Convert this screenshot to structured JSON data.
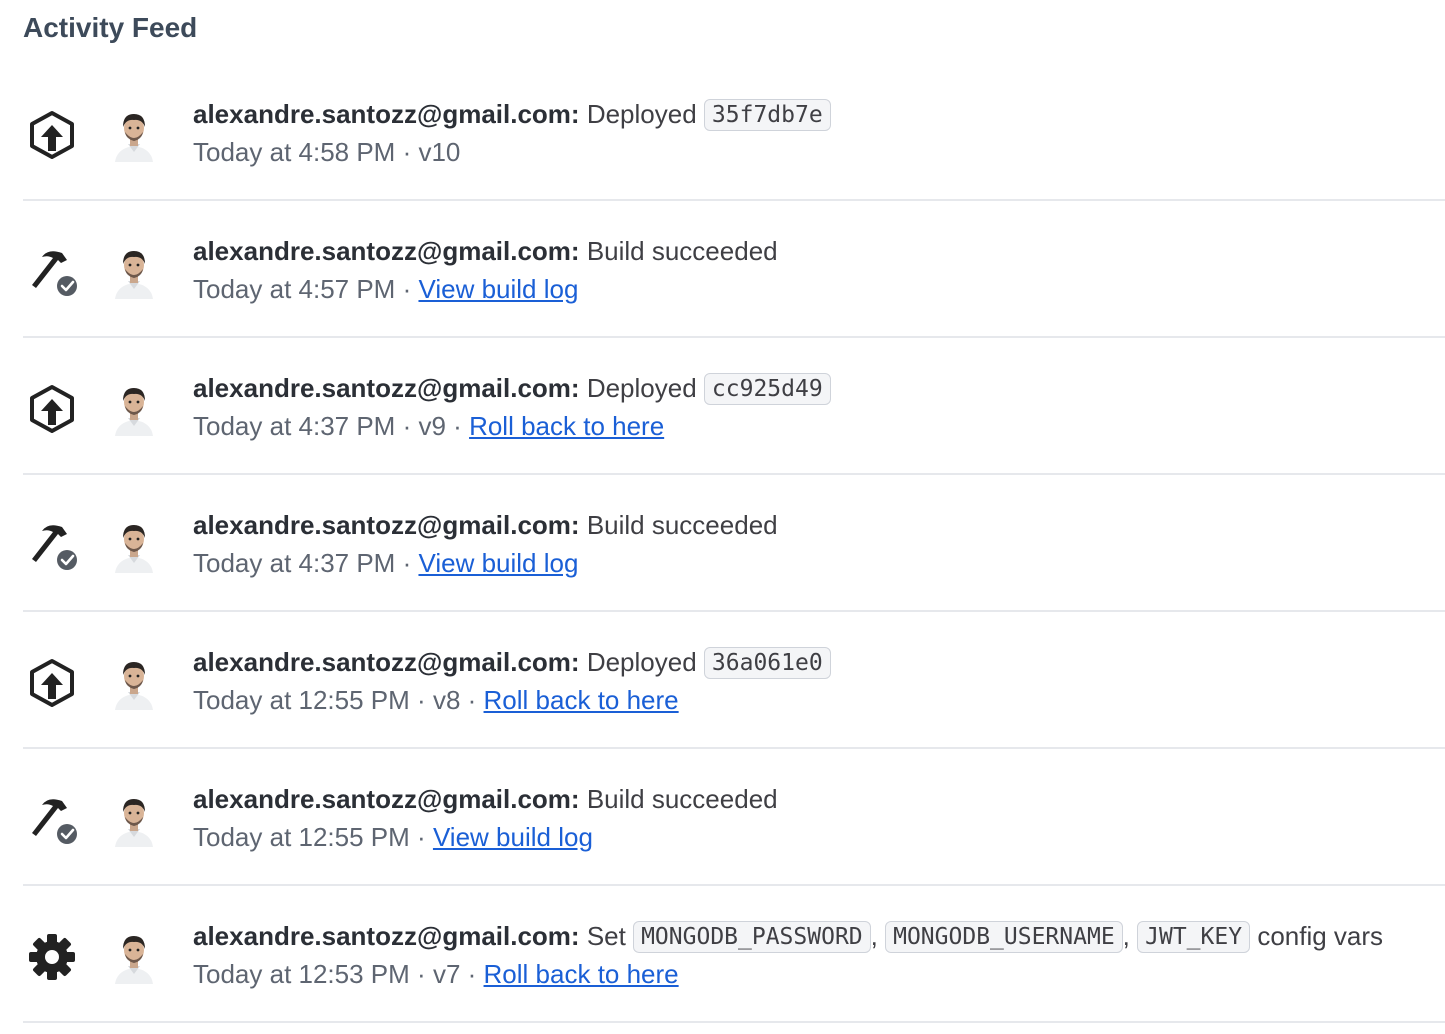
{
  "header": {
    "title": "Activity Feed"
  },
  "items": [
    {
      "icon": "deploy-upload-icon",
      "user": "alexandre.santozz@gmail.com:",
      "action": "Deployed",
      "codes": [
        "35f7db7e"
      ],
      "time": "Today at 4:58 PM",
      "version": "v10",
      "link": null
    },
    {
      "icon": "build-hammer-check-icon",
      "user": "alexandre.santozz@gmail.com:",
      "action": "Build succeeded",
      "codes": [],
      "time": "Today at 4:57 PM",
      "version": null,
      "link": "View build log"
    },
    {
      "icon": "deploy-upload-icon",
      "user": "alexandre.santozz@gmail.com:",
      "action": "Deployed",
      "codes": [
        "cc925d49"
      ],
      "time": "Today at 4:37 PM",
      "version": "v9",
      "link": "Roll back to here"
    },
    {
      "icon": "build-hammer-check-icon",
      "user": "alexandre.santozz@gmail.com:",
      "action": "Build succeeded",
      "codes": [],
      "time": "Today at 4:37 PM",
      "version": null,
      "link": "View build log"
    },
    {
      "icon": "deploy-upload-icon",
      "user": "alexandre.santozz@gmail.com:",
      "action": "Deployed",
      "codes": [
        "36a061e0"
      ],
      "time": "Today at 12:55 PM",
      "version": "v8",
      "link": "Roll back to here"
    },
    {
      "icon": "build-hammer-check-icon",
      "user": "alexandre.santozz@gmail.com:",
      "action": "Build succeeded",
      "codes": [],
      "time": "Today at 12:55 PM",
      "version": null,
      "link": "View build log"
    },
    {
      "icon": "gear-icon",
      "user": "alexandre.santozz@gmail.com:",
      "action": "Set",
      "codes": [
        "MONGODB_PASSWORD",
        "MONGODB_USERNAME",
        "JWT_KEY"
      ],
      "suffix": "config vars",
      "time": "Today at 12:53 PM",
      "version": "v7",
      "link": "Roll back to here"
    }
  ]
}
